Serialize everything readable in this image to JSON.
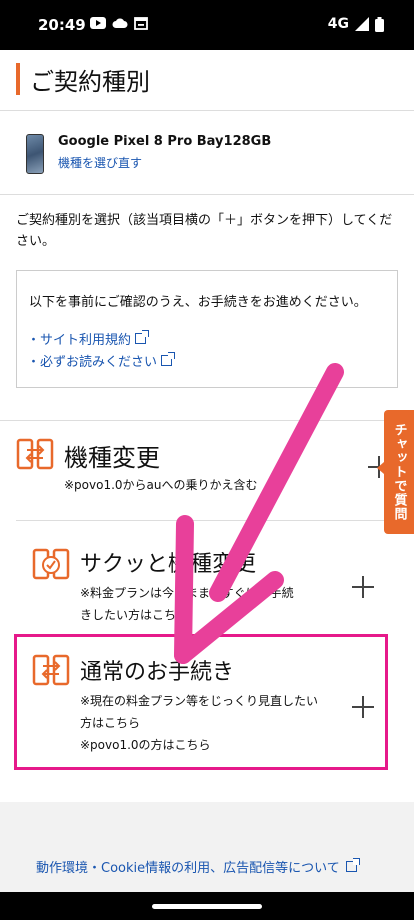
{
  "status_bar": {
    "time": "20:49",
    "network": "4G"
  },
  "page": {
    "title": "ご契約種別",
    "device": {
      "model": "Google Pixel 8 Pro Bay128GB",
      "reselect_link": "機種を選び直す"
    },
    "instruction": "ご契約種別を選択（該当項目横の「＋」ボタンを押下）してください。",
    "notice": {
      "text": "以下を事前にご確認のうえ、お手続きをお進めください。",
      "links": [
        "・サイト利用規約",
        "・必ずお読みください"
      ]
    },
    "options": [
      {
        "label": "機種変更",
        "desc_lines": [
          "※povo1.0からauへの乗りかえ含む"
        ]
      },
      {
        "label": "サクッと機種変更",
        "desc_lines": [
          "※料金プランは今のまま、すぐにお手続",
          "きしたい方はこちら"
        ]
      },
      {
        "label": "通常のお手続き",
        "desc_lines": [
          "※現在の料金プラン等をじっくり見直したい",
          "方はこちら",
          "※povo1.0の方はこちら"
        ]
      }
    ],
    "chat_tab": "チャットで質問",
    "footer_link": "動作環境・Cookie情報の利用、広告配信等について"
  },
  "colors": {
    "accent": "#e8692b",
    "link": "#1a56b0",
    "highlight": "#e6198a"
  }
}
